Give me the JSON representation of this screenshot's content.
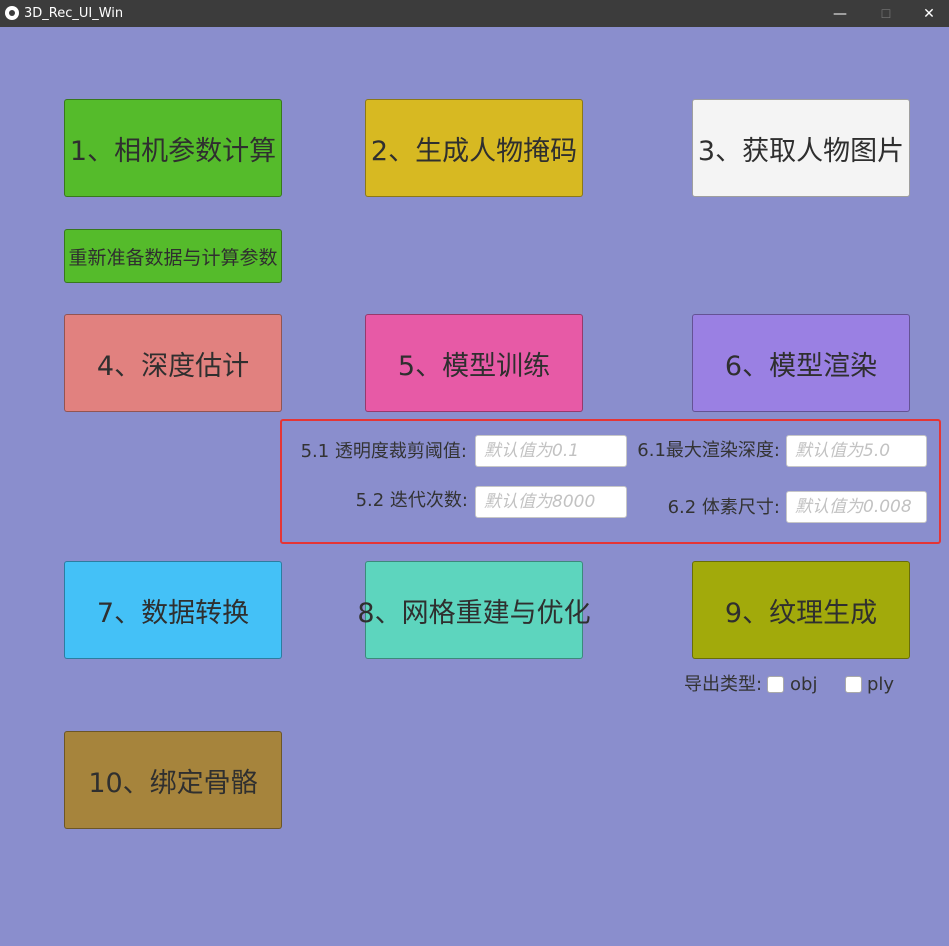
{
  "window": {
    "title": "3D_Rec_UI_Win",
    "minimize_glyph": "—",
    "maximize_glyph": "☐",
    "close_glyph": "✕"
  },
  "buttons": {
    "camera_params": {
      "label": "1、相机参数计算",
      "color": "#55bb2b"
    },
    "person_mask": {
      "label": "2、生成人物掩码",
      "color": "#d7b922"
    },
    "person_images": {
      "label": "3、获取人物图片",
      "color": "#f4f4f4"
    },
    "reprepare": {
      "label": "重新准备数据与计算参数",
      "color": "#55bb2b"
    },
    "depth_estimation": {
      "label": "4、深度估计",
      "color": "#e1817f"
    },
    "model_training": {
      "label": "5、模型训练",
      "color": "#e75aa6"
    },
    "model_rendering": {
      "label": "6、模型渲染",
      "color": "#9a80e3"
    },
    "data_conversion": {
      "label": "7、数据转换",
      "color": "#44c1f7"
    },
    "mesh_rebuild": {
      "label": "8、网格重建与优化",
      "color": "#5dd5be"
    },
    "texture_generation": {
      "label": "9、纹理生成",
      "color": "#a2aa0b"
    },
    "bind_skeleton": {
      "label": "10、绑定骨骼",
      "color": "#a6843c"
    }
  },
  "params": {
    "alpha_clip": {
      "label": "5.1 透明度裁剪阈值:",
      "value": "",
      "placeholder": "默认值为0.1"
    },
    "iterations": {
      "label": "5.2 迭代次数:",
      "value": "",
      "placeholder": "默认值为8000"
    },
    "max_render_depth": {
      "label": "6.1最大渲染深度:",
      "value": "",
      "placeholder": "默认值为5.0"
    },
    "voxel_size": {
      "label": "6.2 体素尺寸:",
      "value": "",
      "placeholder": "默认值为0.008"
    }
  },
  "export": {
    "label": "导出类型:",
    "options": [
      {
        "label": "obj",
        "checked": false
      },
      {
        "label": "ply",
        "checked": false
      }
    ]
  },
  "colors": {
    "background": "#8a8ecd",
    "titlebar": "#3c3c3c",
    "highlight": "#e53535"
  }
}
